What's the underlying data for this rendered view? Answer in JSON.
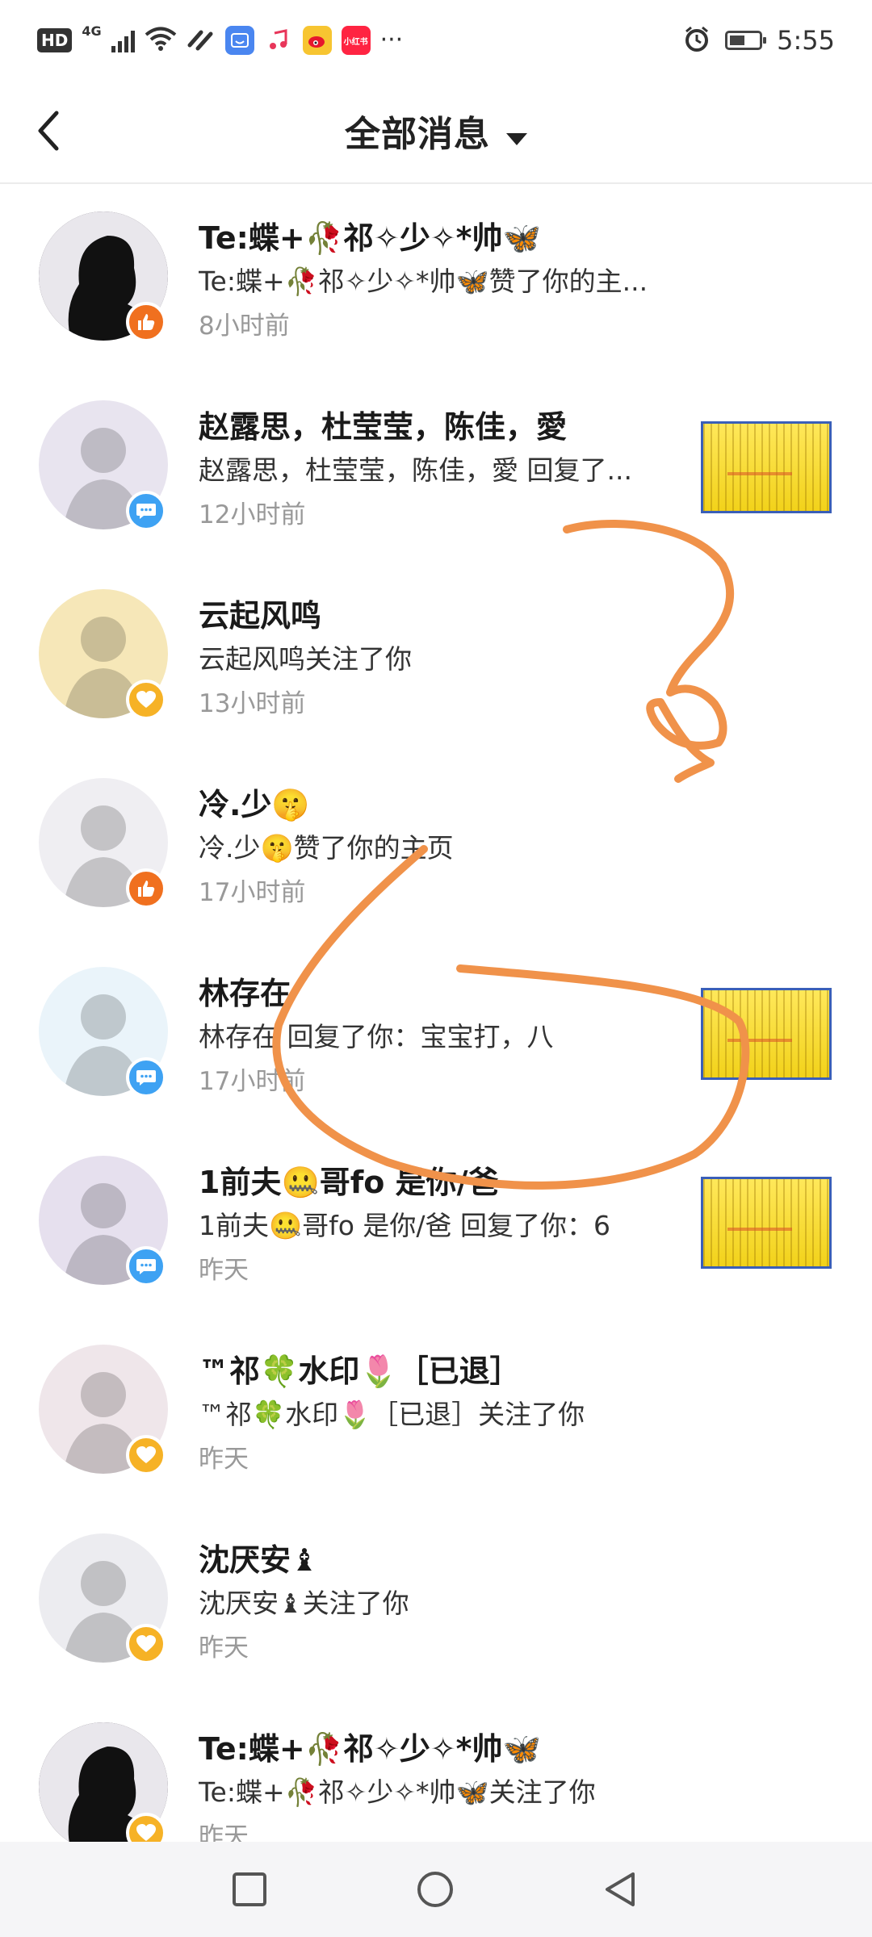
{
  "status_bar": {
    "network_badge": "HD",
    "network_type": "4G",
    "app_icons": [
      "tmall-icon",
      "music-icon",
      "weibo-icon",
      "xiaohongshu-icon"
    ],
    "xiaohongshu_label": "小红书",
    "more": "···",
    "time": "5:55"
  },
  "header": {
    "title": "全部消息"
  },
  "messages": [
    {
      "name": "Te:蝶+🥀祁✧少✧*帅🦋",
      "text": "Te:蝶+🥀祁✧少✧*帅🦋赞了你的主...",
      "time": "8小时前",
      "badge": "like",
      "avatar_color": "#2a2230",
      "has_thumb": false
    },
    {
      "name": "赵露思，杜莹莹，陈佳，愛",
      "text": "赵露思，杜莹莹，陈佳，愛 回复了...",
      "time": "12小时前",
      "badge": "comment",
      "avatar_color": "#e8e4ef",
      "has_thumb": true
    },
    {
      "name": "云起风鸣",
      "text": "云起风鸣关注了你",
      "time": "13小时前",
      "badge": "follow",
      "avatar_color": "#f6e7b8",
      "has_thumb": false
    },
    {
      "name": "冷.少🤫",
      "text": "冷.少🤫赞了你的主页",
      "time": "17小时前",
      "badge": "like",
      "avatar_color": "#efeef2",
      "has_thumb": false
    },
    {
      "name": "林存在",
      "text": "林存在 回复了你：宝宝打，八",
      "time": "17小时前",
      "badge": "comment",
      "avatar_color": "#eaf4fa",
      "has_thumb": true
    },
    {
      "name": "1前夫🤐哥fo 是你/爸",
      "text": "1前夫🤐哥fo 是你/爸 回复了你：6",
      "time": "昨天",
      "badge": "comment",
      "avatar_color": "#e6e0ee",
      "has_thumb": true
    },
    {
      "name": "™祁🍀水印🌷［已退］",
      "text": "™祁🍀水印🌷［已退］关注了你",
      "time": "昨天",
      "badge": "follow",
      "avatar_color": "#efe6ea",
      "has_thumb": false
    },
    {
      "name": "沈厌安♝",
      "text": "沈厌安♝关注了你",
      "time": "昨天",
      "badge": "follow",
      "avatar_color": "#ececf0",
      "has_thumb": false
    },
    {
      "name": "Te:蝶+🥀祁✧少✧*帅🦋",
      "text": "Te:蝶+🥀祁✧少✧*帅🦋关注了你",
      "time": "昨天",
      "badge": "follow",
      "avatar_color": "#2a2230",
      "has_thumb": false
    }
  ],
  "colors": {
    "like_badge": "#f0701f",
    "comment_badge": "#3ea2f3",
    "follow_badge": "#f6b226",
    "annotation_stroke": "#f0924a"
  }
}
